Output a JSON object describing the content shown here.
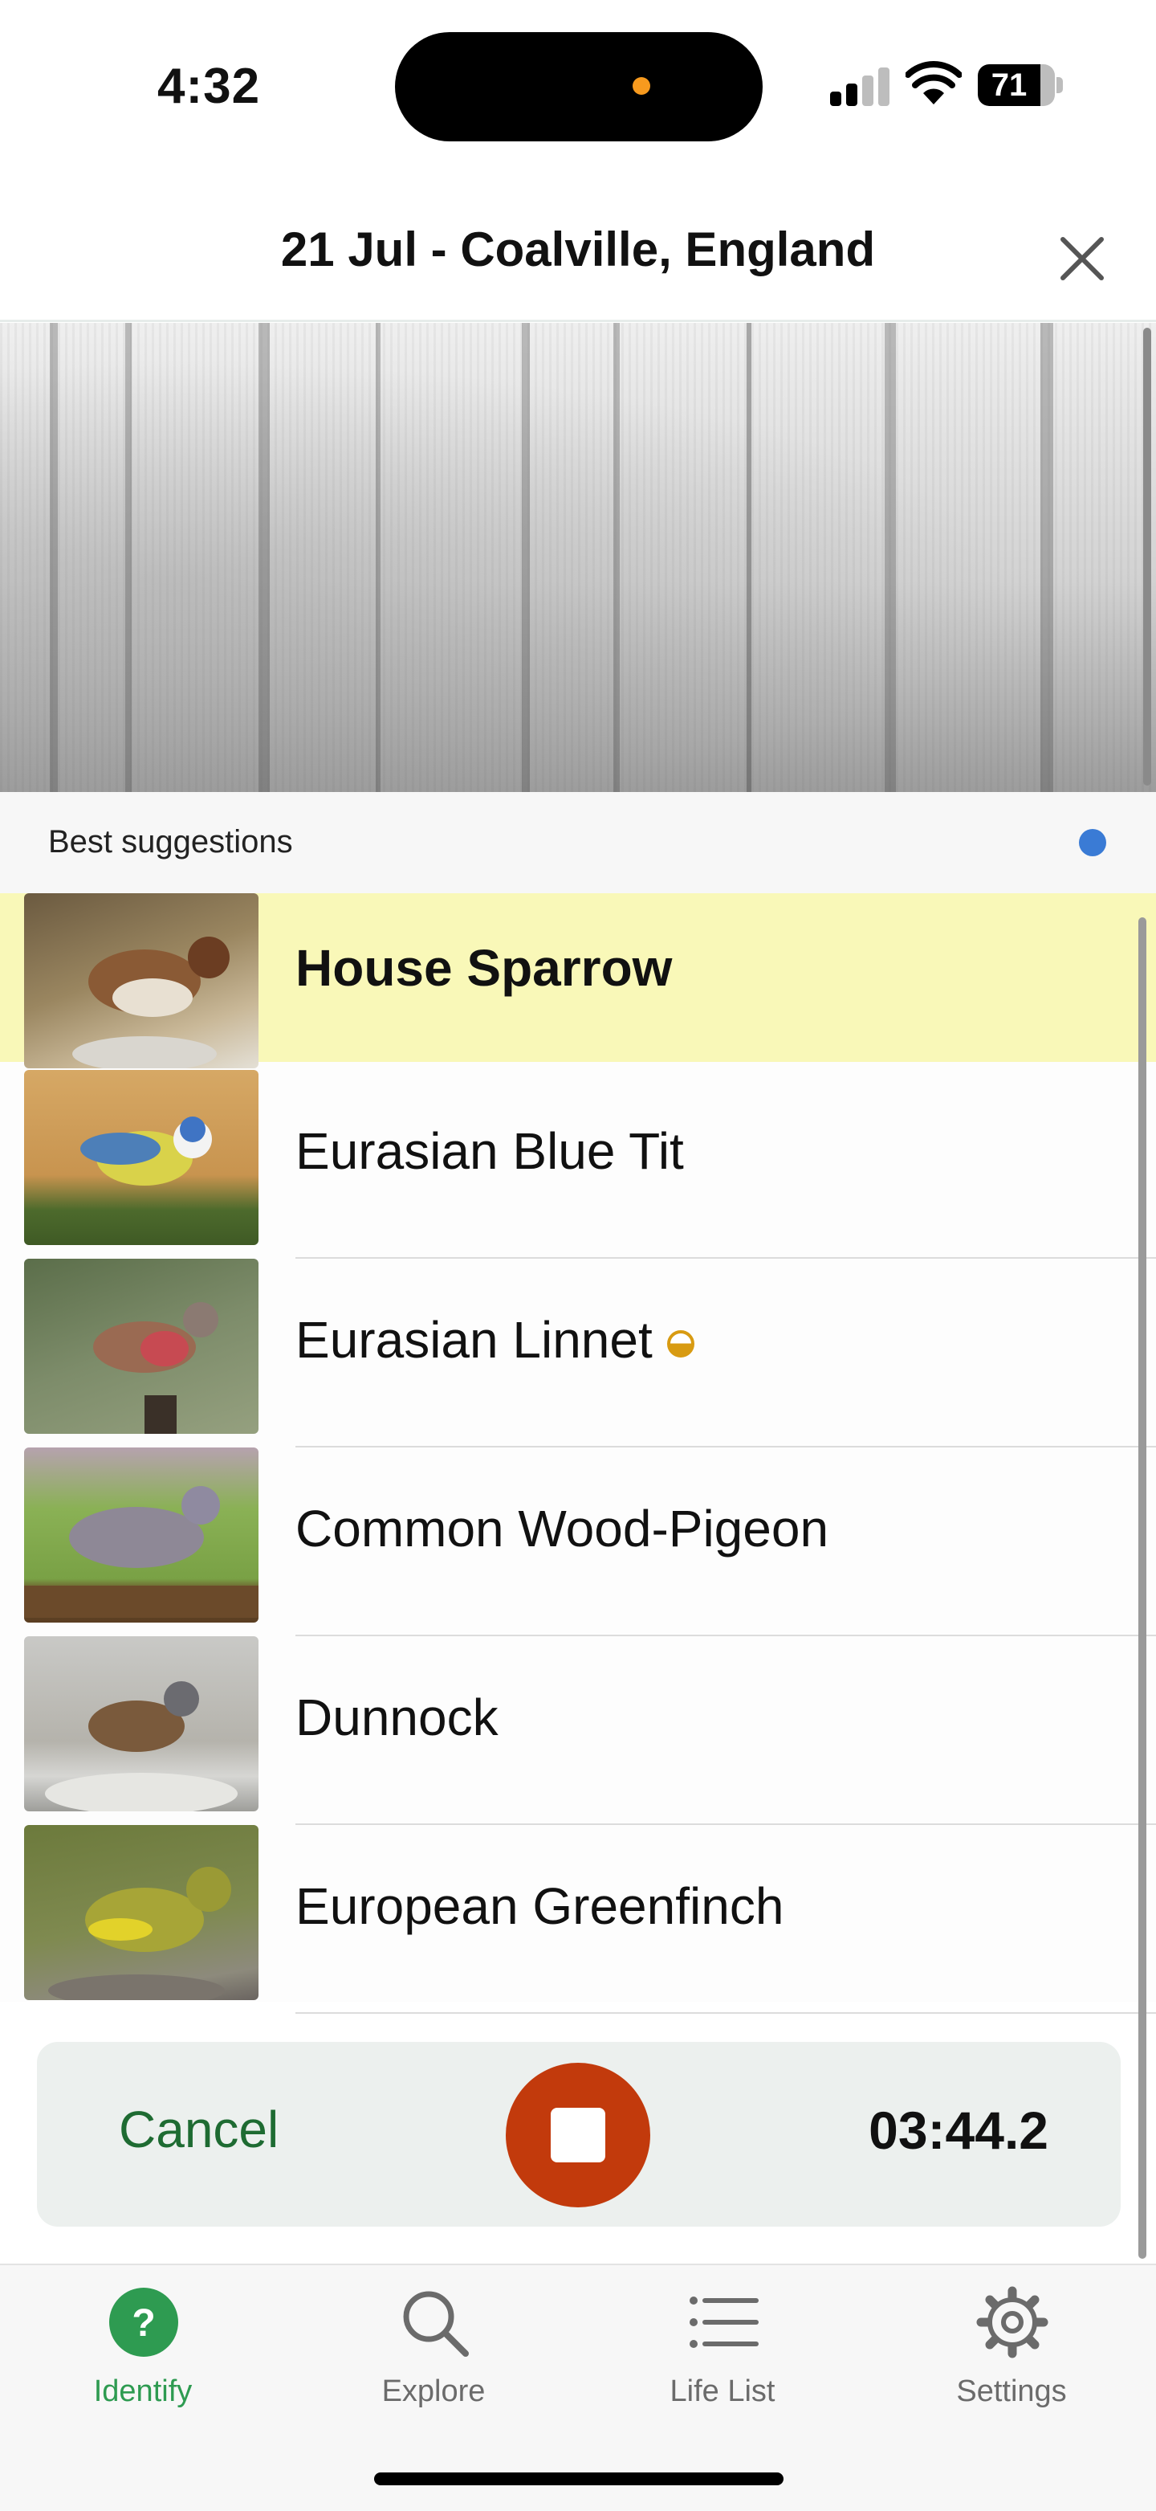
{
  "status_bar": {
    "time": "4:32",
    "battery": "71",
    "battery_level": 0.71
  },
  "header": {
    "title": "21 Jul - Coalville, England",
    "close_icon": "close-icon"
  },
  "suggestions": {
    "title": "Best suggestions",
    "items": [
      {
        "name": "House Sparrow",
        "best": true
      },
      {
        "name": "Eurasian Blue Tit"
      },
      {
        "name": "Eurasian Linnet",
        "badge": "half-filled-circle-icon"
      },
      {
        "name": "Common Wood-Pigeon"
      },
      {
        "name": "Dunnock"
      },
      {
        "name": "European Greenfinch"
      }
    ]
  },
  "recording": {
    "cancel_label": "Cancel",
    "timer": "03:44.2",
    "stop_icon": "stop-icon"
  },
  "tabs": [
    {
      "label": "Identify",
      "icon": "question-icon",
      "active": true
    },
    {
      "label": "Explore",
      "icon": "magnifier-icon"
    },
    {
      "label": "Life List",
      "icon": "list-icon"
    },
    {
      "label": "Settings",
      "icon": "gear-icon"
    }
  ],
  "colors": {
    "accent_green": "#2e9b51",
    "stop_red": "#c23a0c",
    "highlight_yellow": "#f9f8b8",
    "live_blue": "#3a7bd5"
  }
}
